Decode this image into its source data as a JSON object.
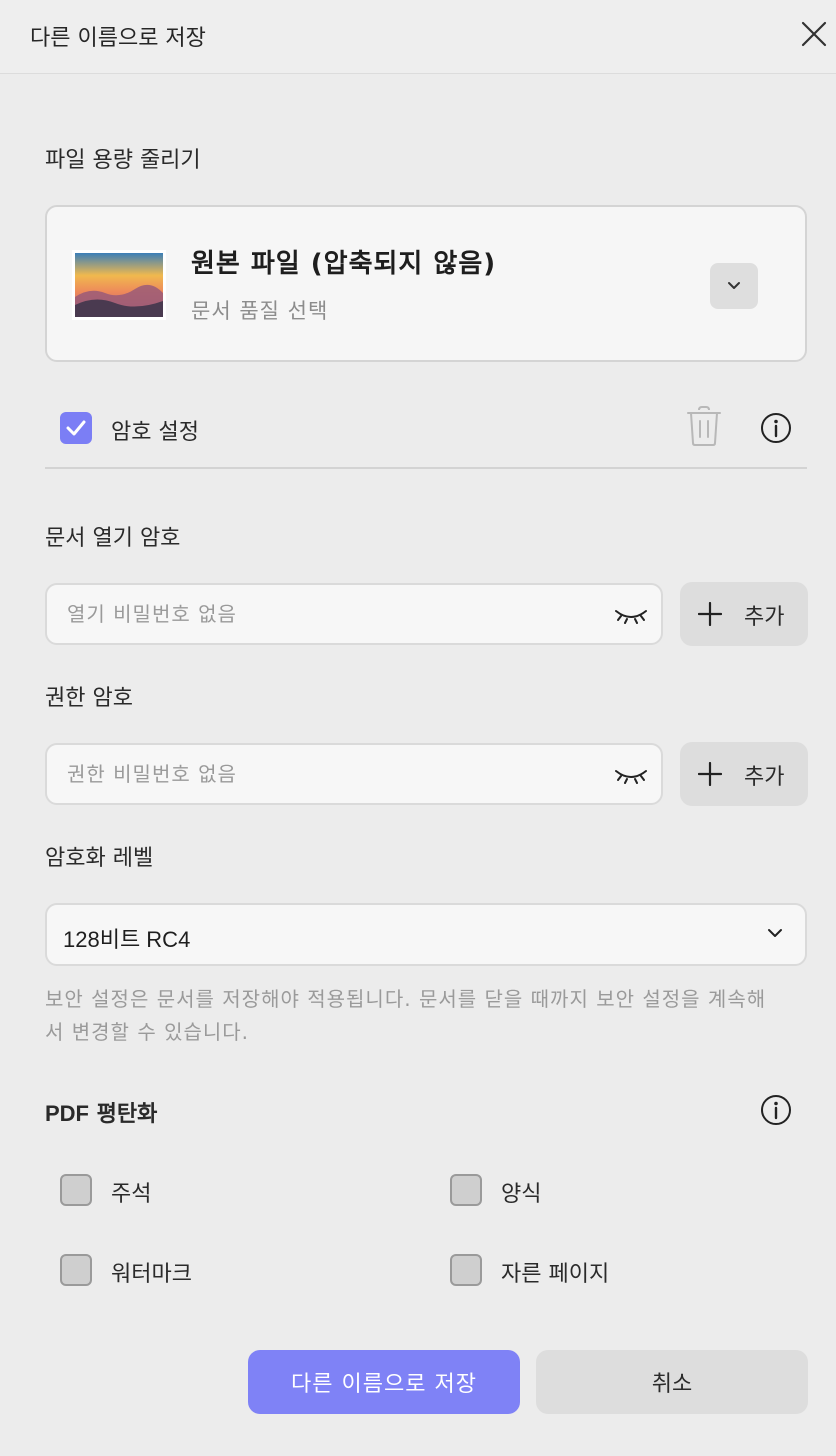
{
  "dialog": {
    "title": "다른 이름으로 저장"
  },
  "compression": {
    "label": "파일 용량 줄리기",
    "option_title": "원본 파일 (압축되지 않음)",
    "option_subtitle": "문서 품질 선택"
  },
  "password": {
    "checkbox_label": "암호 설정",
    "checked": true,
    "open": {
      "label": "문서 열기 암호",
      "placeholder": "열기 비밀번호 없음",
      "add_label": "추가"
    },
    "permission": {
      "label": "권한 암호",
      "placeholder": "권한 비밀번호 없음",
      "add_label": "추가"
    }
  },
  "encryption": {
    "label": "암호화 레벨",
    "value": "128비트 RC4",
    "note": "보안 설정은 문서를 저장해야 적용됩니다. 문서를 닫을 때까지 보안 설정을 계속해서 변경할 수 있습니다."
  },
  "flatten": {
    "label_prefix": "PDF",
    "label_suffix": " 평탄화",
    "options": [
      {
        "label": "주석",
        "checked": false
      },
      {
        "label": "양식",
        "checked": false
      },
      {
        "label": "워터마크",
        "checked": false
      },
      {
        "label": "자른 페이지",
        "checked": false
      }
    ]
  },
  "buttons": {
    "save": "다른 이름으로 저장",
    "cancel": "취소"
  },
  "colors": {
    "accent": "#7f82f6",
    "checkbox_checked": "#7b7ef5",
    "background": "#ececec"
  }
}
